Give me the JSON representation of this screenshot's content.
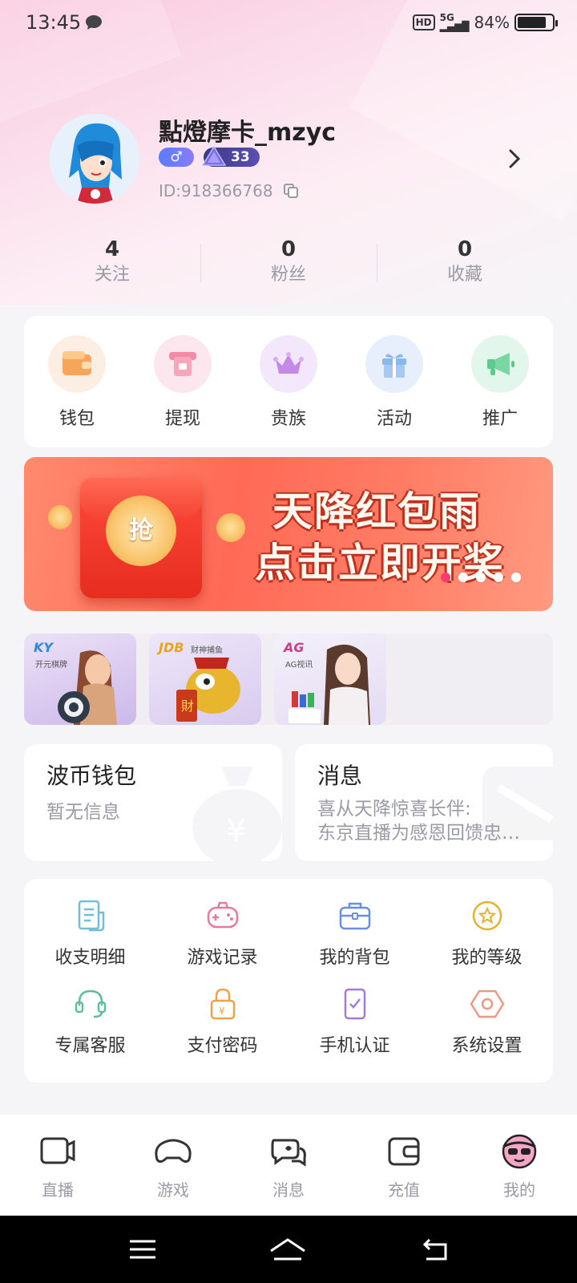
{
  "status_bar": {
    "time": "13:45",
    "network_badge": "HD",
    "signal": "5G",
    "battery": "84%",
    "battery_level": 0.84
  },
  "profile": {
    "name": "點燈摩卡_mzyc",
    "gender_symbol": "♂",
    "level": "33",
    "id_text": "ID:918366768"
  },
  "stats": [
    {
      "value": "4",
      "label": "关注"
    },
    {
      "value": "0",
      "label": "粉丝"
    },
    {
      "value": "0",
      "label": "收藏"
    }
  ],
  "quick_actions": [
    {
      "label": "钱包",
      "icon": "wallet-icon"
    },
    {
      "label": "提现",
      "icon": "withdraw-icon"
    },
    {
      "label": "贵族",
      "icon": "crown-icon"
    },
    {
      "label": "活动",
      "icon": "gift-icon"
    },
    {
      "label": "推广",
      "icon": "megaphone-icon"
    }
  ],
  "banner": {
    "coin_text": "抢",
    "line1": "天降红包雨",
    "line2": "点击立即开奖",
    "slide_count": 5,
    "active_slide": 1
  },
  "games": [
    {
      "logo": "KY",
      "sub": "开元棋牌"
    },
    {
      "logo": "JDB",
      "sub": "财神捕鱼"
    },
    {
      "logo": "AG",
      "sub": "AG视讯"
    }
  ],
  "wallet_card": {
    "title": "波币钱包",
    "subtitle": "暂无信息"
  },
  "message_card": {
    "title": "消息",
    "line1": "喜从天降惊喜长伴:",
    "line2": "东京直播为感恩回馈忠…"
  },
  "tools": [
    {
      "label": "收支明细",
      "icon": "bill-icon"
    },
    {
      "label": "游戏记录",
      "icon": "gamepad-icon"
    },
    {
      "label": "我的背包",
      "icon": "bag-icon"
    },
    {
      "label": "我的等级",
      "icon": "star-badge-icon"
    },
    {
      "label": "专属客服",
      "icon": "headset-icon"
    },
    {
      "label": "支付密码",
      "icon": "lock-icon"
    },
    {
      "label": "手机认证",
      "icon": "phone-check-icon"
    },
    {
      "label": "系统设置",
      "icon": "settings-icon"
    }
  ],
  "bottom_nav": [
    {
      "label": "直播",
      "icon": "live-camera-icon"
    },
    {
      "label": "游戏",
      "icon": "game-controller-icon"
    },
    {
      "label": "消息",
      "icon": "chat-bubbles-icon"
    },
    {
      "label": "充值",
      "icon": "recharge-wallet-icon"
    },
    {
      "label": "我的",
      "icon": "avatar-icon",
      "active": true
    }
  ],
  "colors": {
    "accent_pink": "#ff3a6a",
    "banner_red": "#ff6a56",
    "level_purple": "#5c4fb0"
  }
}
